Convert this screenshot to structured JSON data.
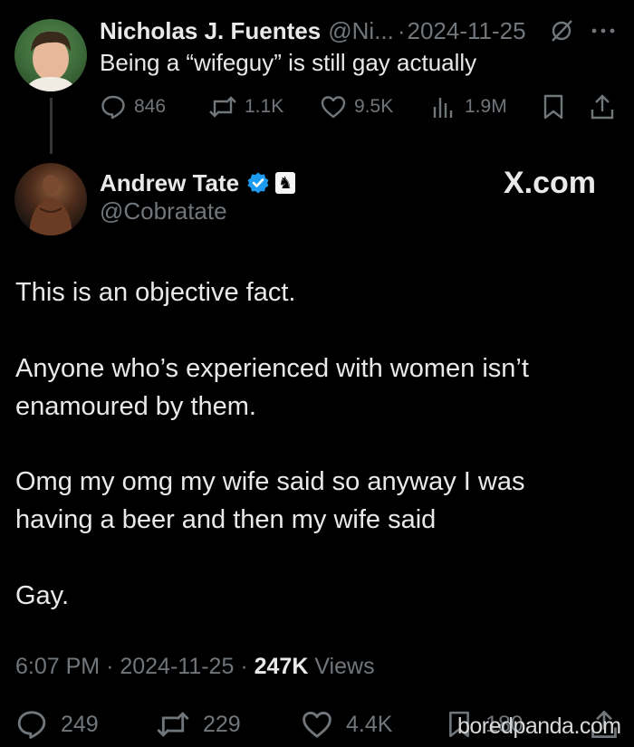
{
  "parent_tweet": {
    "display_name": "Nicholas J. Fuentes",
    "handle": "@Ni...",
    "separator": "·",
    "date": "2024-11-25",
    "text": "Being a “wifeguy” is still gay actually",
    "stats": {
      "replies": "846",
      "reposts": "1.1K",
      "likes": "9.5K",
      "views": "1.9M"
    }
  },
  "main_tweet": {
    "display_name": "Andrew Tate",
    "handle": "@Cobratate",
    "source": "X.com",
    "paragraphs": [
      "This is an objective fact.",
      "Anyone who’s experienced with women isn’t",
      "enamoured by them.",
      "Omg my omg my wife said so anyway I was",
      "having a beer and then my wife said",
      "Gay."
    ],
    "time": "6:07 PM",
    "separator": "·",
    "date": "2024-11-25",
    "views_count": "247K",
    "views_label": "Views",
    "stats": {
      "replies": "249",
      "reposts": "229",
      "likes": "4.4K",
      "bookmarks": "180"
    }
  },
  "watermark": "boredpanda.com",
  "colors": {
    "background": "#000000",
    "text_primary": "#e7e9ea",
    "text_muted": "#71767b",
    "verified_blue": "#1d9bf0"
  },
  "icons": {
    "reply": "reply-icon",
    "repost": "repost-icon",
    "like": "heart-icon",
    "views": "analytics-icon",
    "bookmark": "bookmark-icon",
    "share": "share-icon",
    "grok": "grok-icon",
    "more": "more-icon",
    "verified": "verified-badge-icon",
    "affiliate": "chess-knight-icon"
  }
}
